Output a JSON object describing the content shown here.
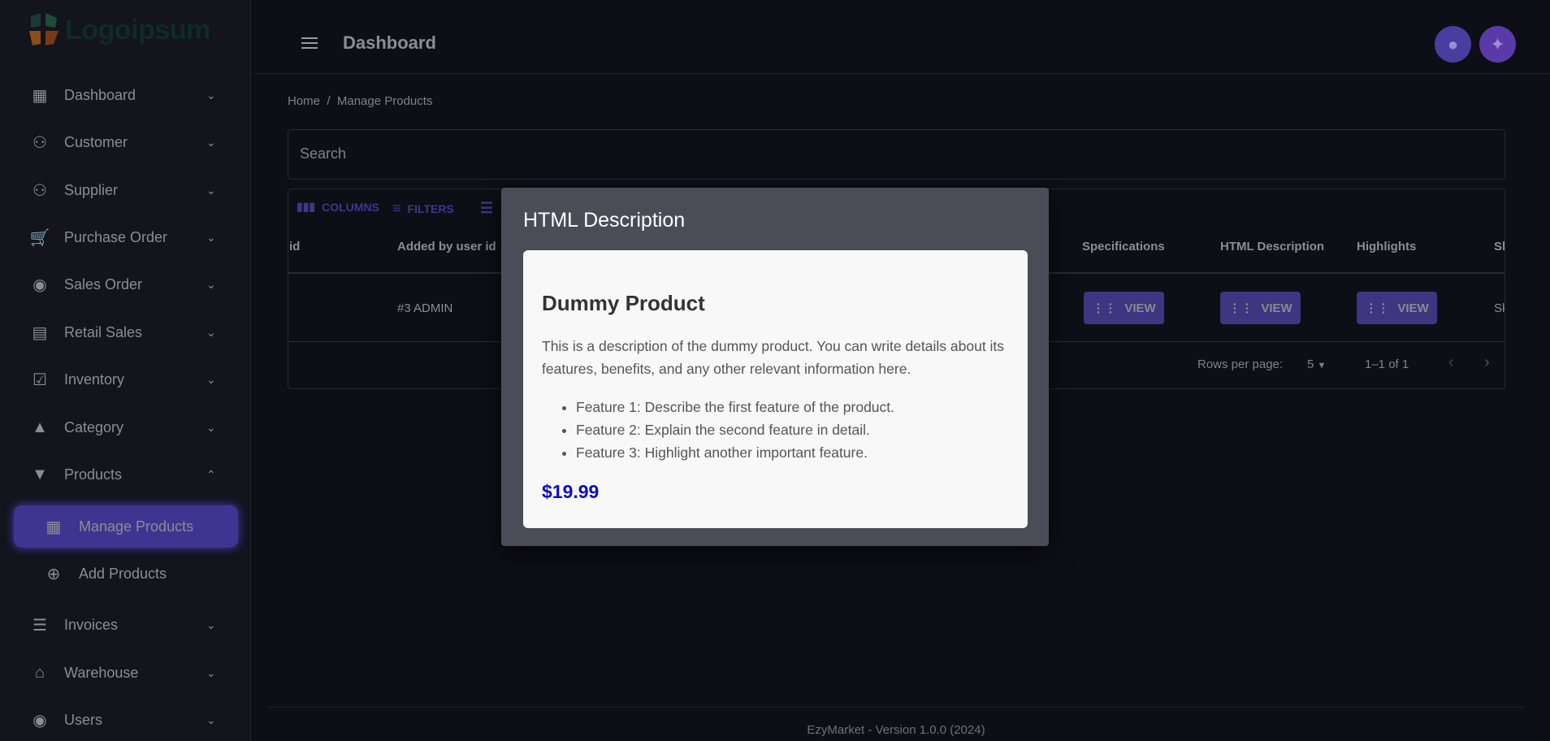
{
  "logo": {
    "text": "Logoipsum"
  },
  "sidebar": {
    "items": [
      {
        "label": "Dashboard",
        "icon": "dashboard-icon"
      },
      {
        "label": "Customer",
        "icon": "people-icon"
      },
      {
        "label": "Supplier",
        "icon": "people-icon"
      },
      {
        "label": "Purchase Order",
        "icon": "cart-icon"
      },
      {
        "label": "Sales Order",
        "icon": "account-circle-icon"
      },
      {
        "label": "Retail Sales",
        "icon": "store-icon"
      },
      {
        "label": "Inventory",
        "icon": "clipboard-check-icon"
      },
      {
        "label": "Category",
        "icon": "shapes-icon"
      },
      {
        "label": "Products",
        "icon": "basket-icon"
      },
      {
        "label": "Manage Products",
        "icon": "dashboard-icon",
        "active": true
      },
      {
        "label": "Add Products",
        "icon": "add-circle-icon"
      },
      {
        "label": "Invoices",
        "icon": "list-icon"
      },
      {
        "label": "Warehouse",
        "icon": "warehouse-icon"
      },
      {
        "label": "Users",
        "icon": "account-circle-icon"
      }
    ]
  },
  "header": {
    "title": "Dashboard"
  },
  "breadcrumb": {
    "home": "Home",
    "sep": "/",
    "current": "Manage Products"
  },
  "search": {
    "placeholder": "Search"
  },
  "toolbar": {
    "columns": "COLUMNS",
    "filters": "FILTERS"
  },
  "table": {
    "columns": [
      "id",
      "Added by user id",
      "Specifications",
      "HTML Description",
      "Highlights",
      "Sk"
    ],
    "row": {
      "added_by": "#3 ADMIN",
      "view": "VIEW",
      "sku": "Sk"
    },
    "footer": {
      "rows_per_page_label": "Rows per page:",
      "rows_per_page": "5",
      "range": "1–1 of 1"
    }
  },
  "modal": {
    "title": "HTML Description",
    "heading": "Dummy Product",
    "paragraph": "This is a description of the dummy product. You can write details about its features, benefits, and any other relevant information here.",
    "features": [
      "Feature 1: Describe the first feature of the product.",
      "Feature 2: Explain the second feature in detail.",
      "Feature 3: Highlight another important feature."
    ],
    "price": "$19.99"
  },
  "footer": {
    "version": "EzyMarket - Version 1.0.0 (2024)"
  },
  "colors": {
    "accent": "#3f3580",
    "price": "#0d0dc4",
    "modal_bg": "#4a4c57"
  }
}
